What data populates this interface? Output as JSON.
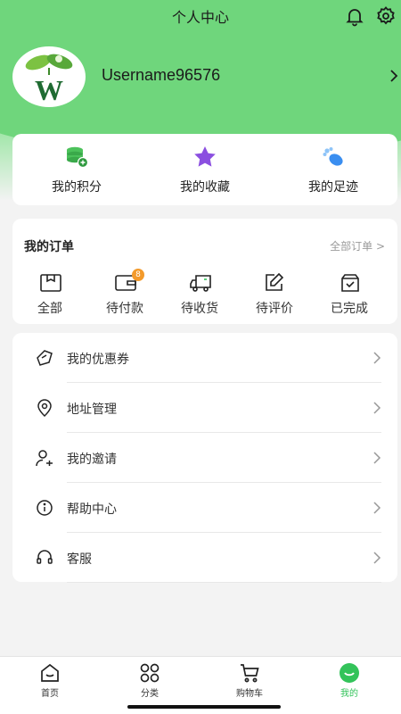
{
  "header": {
    "title": "个人中心"
  },
  "profile": {
    "username": "Username96576",
    "avatar_letter": "W"
  },
  "quick": [
    {
      "label": "我的积分",
      "icon": "coins-stack-icon"
    },
    {
      "label": "我的收藏",
      "icon": "star-icon"
    },
    {
      "label": "我的足迹",
      "icon": "footprint-icon"
    }
  ],
  "orders": {
    "title": "我的订单",
    "all_label": "全部订单 >",
    "items": [
      {
        "label": "全部",
        "icon": "box-icon"
      },
      {
        "label": "待付款",
        "icon": "wallet-icon",
        "badge": "8"
      },
      {
        "label": "待收货",
        "icon": "truck-icon"
      },
      {
        "label": "待评价",
        "icon": "edit-icon"
      },
      {
        "label": "已完成",
        "icon": "check-box-icon"
      }
    ]
  },
  "menu": [
    {
      "label": "我的优惠券",
      "icon": "coupon-icon"
    },
    {
      "label": "地址管理",
      "icon": "location-icon"
    },
    {
      "label": "我的邀请",
      "icon": "invite-user-icon"
    },
    {
      "label": "帮助中心",
      "icon": "info-icon"
    },
    {
      "label": "客服",
      "icon": "headset-icon"
    }
  ],
  "tabs": [
    {
      "label": "首页",
      "icon": "home-icon"
    },
    {
      "label": "分类",
      "icon": "category-icon"
    },
    {
      "label": "购物车",
      "icon": "cart-icon"
    },
    {
      "label": "我的",
      "icon": "profile-smile-icon",
      "active": true
    }
  ],
  "colors": {
    "accent": "#33c35a",
    "header_green": "#6fd67c",
    "badge": "#f39a2b"
  }
}
